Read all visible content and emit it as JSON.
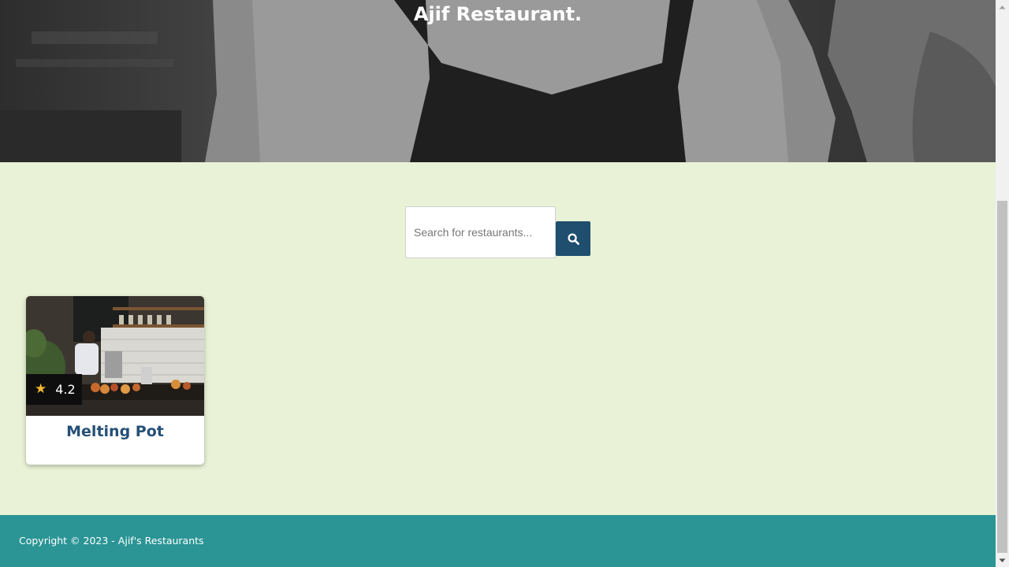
{
  "hero": {
    "title": "Ajif Restaurant."
  },
  "search": {
    "placeholder": "Search for restaurants...",
    "value": "",
    "button_icon": "search-icon",
    "button_color": "#1f4e6f"
  },
  "restaurants": [
    {
      "name": "Melting Pot",
      "rating": "4.2",
      "rating_icon": "star-icon"
    }
  ],
  "footer": {
    "copyright": "Copyright © 2023 - Ajif's Restaurants"
  },
  "colors": {
    "page_background": "#e9f2d6",
    "footer_background": "#2b9595",
    "card_title": "#255077",
    "star": "#f5b931"
  }
}
